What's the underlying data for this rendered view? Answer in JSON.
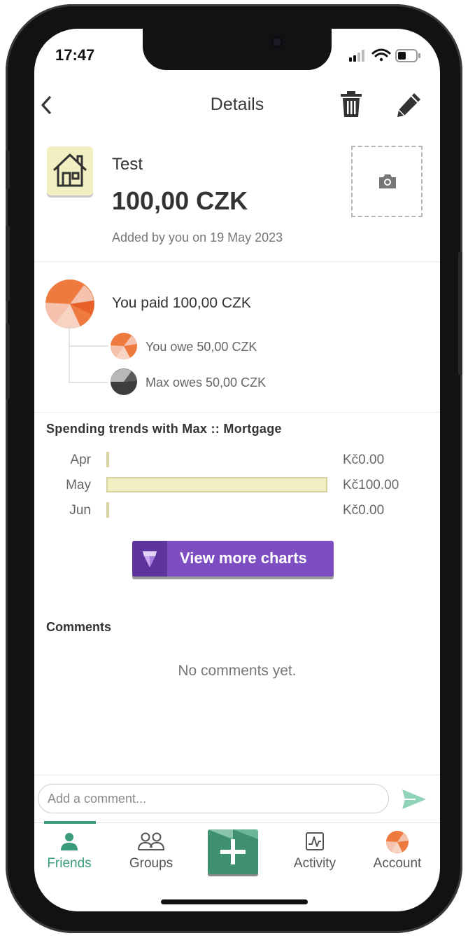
{
  "status_bar": {
    "time": "17:47"
  },
  "header": {
    "title": "Details",
    "back_icon": "chevron-left-icon",
    "delete_icon": "trash-icon",
    "edit_icon": "pencil-icon"
  },
  "expense": {
    "category_icon": "house-icon",
    "name": "Test",
    "amount": "100,00 CZK",
    "added_by": "Added by you on 19 May 2023",
    "photo_icon": "camera-icon"
  },
  "payment": {
    "paid_text": "You paid 100,00 CZK",
    "shares": [
      {
        "text": "You owe 50,00 CZK",
        "avatar": "orange-pie-avatar"
      },
      {
        "text": "Max owes 50,00 CZK",
        "avatar": "gray-pie-avatar"
      }
    ]
  },
  "trends": {
    "title": "Spending trends with Max :: Mortgage",
    "rows": [
      {
        "month": "Apr",
        "value_label": "Kč0.00",
        "value": 0
      },
      {
        "month": "May",
        "value_label": "Kč100.00",
        "value": 100
      },
      {
        "month": "Jun",
        "value_label": "Kč0.00",
        "value": 0
      }
    ],
    "max_value": 100,
    "button_label": "View more charts",
    "button_icon": "gem-icon"
  },
  "comments": {
    "title": "Comments",
    "empty_text": "No comments yet.",
    "placeholder": "Add a comment...",
    "send_icon": "send-icon"
  },
  "tabbar": {
    "tabs": [
      {
        "label": "Friends",
        "icon": "person-icon",
        "active": true
      },
      {
        "label": "Groups",
        "icon": "people-icon",
        "active": false
      },
      {
        "label": "",
        "icon": "plus-icon",
        "active": false
      },
      {
        "label": "Activity",
        "icon": "activity-icon",
        "active": false
      },
      {
        "label": "Account",
        "icon": "account-avatar-icon",
        "active": false
      }
    ]
  },
  "colors": {
    "accent": "#3a9b7a",
    "purple": "#7d4ec2",
    "orange": "#ee7a3f",
    "bar_fill": "#f2efc2"
  }
}
